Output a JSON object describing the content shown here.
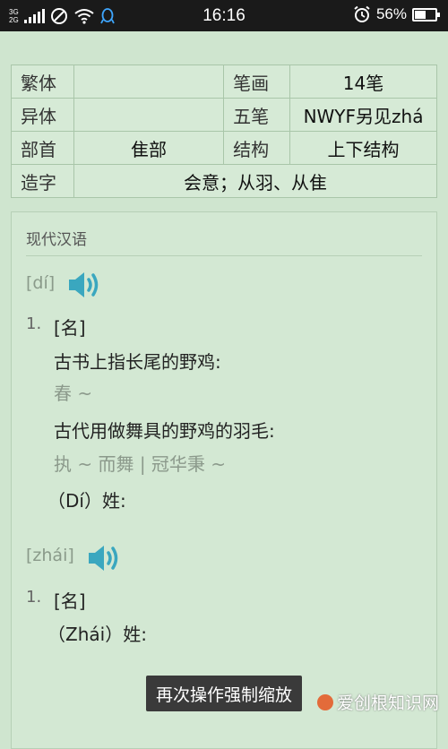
{
  "status_bar": {
    "net_top": "3G",
    "net_bottom": "2G",
    "time": "16:16",
    "battery_percent": "56%",
    "battery_level": 0.56
  },
  "info_table": {
    "rows": [
      {
        "l1": "繁体",
        "v1": "",
        "l2": "笔画",
        "v2": "14笔"
      },
      {
        "l1": "异体",
        "v1": "",
        "l2": "五笔",
        "v2": "NWYF另见zhá"
      },
      {
        "l1": "部首",
        "v1": "隹部",
        "l2": "结构",
        "v2": "上下结构"
      },
      {
        "l1": "造字",
        "v1": "会意；从羽、从隹"
      }
    ]
  },
  "dictionary": {
    "title": "现代汉语",
    "readings": [
      {
        "pinyin": "[dí]",
        "senses": [
          {
            "number": "1.",
            "pos": "[名]",
            "definitions": [
              {
                "text": "古书上指长尾的野鸡:",
                "example": "春 ~"
              },
              {
                "text": "古代用做舞具的野鸡的羽毛:",
                "example": "执 ~ 而舞 | 冠华秉 ~"
              }
            ],
            "surname": "（Dí）姓:"
          }
        ]
      },
      {
        "pinyin": "[zhái]",
        "senses": [
          {
            "number": "1.",
            "pos": "[名]",
            "surname": "（Zhái）姓:"
          }
        ]
      }
    ]
  },
  "toast": "再次操作强制缩放",
  "watermark": "爱创根知识网",
  "colors": {
    "background": "#cfe5cf",
    "speaker": "#3aa7bf",
    "status_bar": "#1a1a1a"
  }
}
